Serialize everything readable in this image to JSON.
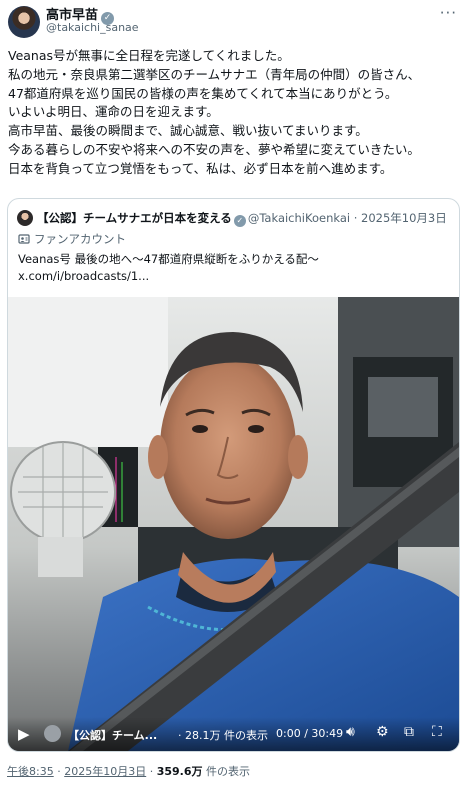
{
  "author": {
    "name": "高市早苗",
    "handle": "@takaichi_sanae"
  },
  "post": {
    "lines": [
      "Veanas号が無事に全日程を完遂してくれました。",
      "私の地元・奈良県第二選挙区のチームサナエ（青年局の仲間）の皆さん、",
      "47都道府県を巡り国民の皆様の声を集めてくれて本当にありがとう。",
      "いよいよ明日、運命の日を迎えます。",
      "高市早苗、最後の瞬間まで、誠心誠意、戦い抜いてまいります。",
      "今ある暮らしの不安や将来への不安の声を、夢や希望に変えていきたい。",
      "日本を背負って立つ覚悟をもって、私は、必ず日本を前へ進めます。"
    ]
  },
  "quote": {
    "name": "【公認】チームサナエが日本を変える",
    "handle": "@TakaichiKoenkai",
    "sep": "·",
    "date": "2025年10月3日",
    "account_type": "ファンアカウント",
    "text_line1": "Veanas号 最後の地へ～47都道府県縦断をふりかえる配～",
    "text_line2": "x.com/i/broadcasts/1..."
  },
  "video": {
    "title": "【公認】チーム...",
    "views": "28.1万 件の表示",
    "time": "0:00 / 30:49"
  },
  "footer": {
    "time": "午後8:35",
    "sep1": "·",
    "date": "2025年10月3日",
    "sep2": "·",
    "views_count": "359.6万",
    "views_label": " 件の表示"
  },
  "icons": {
    "verified": "verified-badge-icon",
    "more": "more-dots-icon",
    "play": "play-icon",
    "volume": "volume-icon",
    "settings": "gear-icon",
    "popout": "popout-icon",
    "fullscreen": "fullscreen-icon"
  },
  "colors": {
    "text": "#0f1419",
    "secondary": "#536471",
    "border": "#cfd9de",
    "verified_gray": "#829aab"
  }
}
